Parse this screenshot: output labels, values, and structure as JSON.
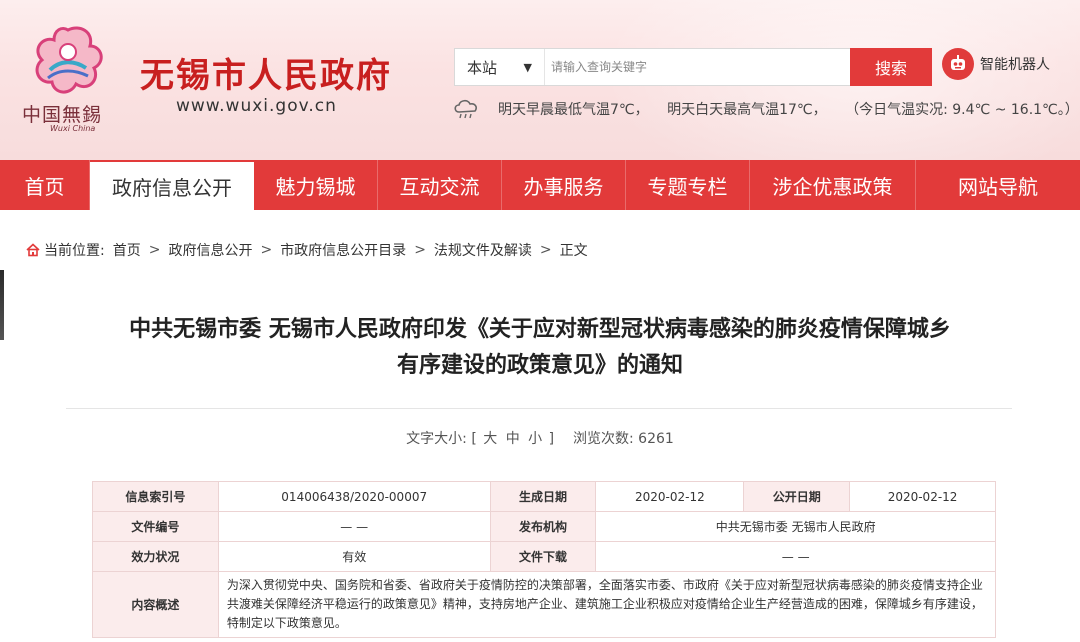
{
  "header": {
    "logo_caption": "中国無錫",
    "logo_sub": "Wuxi China",
    "site_title": "无锡市人民政府",
    "site_url": "www.wuxi.gov.cn",
    "search": {
      "scope": "本站",
      "placeholder": "请输入查询关键字",
      "button_label": "搜索"
    },
    "robot_label": "智能机器人",
    "weather": {
      "low": "明天早晨最低气温7℃，",
      "high": "明天白天最高气温17℃，",
      "today": "（今日气温实况: 9.4℃ ~ 16.1℃。）"
    }
  },
  "nav": {
    "items": [
      {
        "label": "首页"
      },
      {
        "label": "政府信息公开",
        "active": true
      },
      {
        "label": "魅力锡城"
      },
      {
        "label": "互动交流"
      },
      {
        "label": "办事服务"
      },
      {
        "label": "专题专栏"
      },
      {
        "label": "涉企优惠政策"
      },
      {
        "label": "网站导航"
      }
    ]
  },
  "breadcrumb": {
    "prefix": "当前位置:",
    "items": [
      "首页",
      "政府信息公开",
      "市政府信息公开目录",
      "法规文件及解读"
    ],
    "current": "正文"
  },
  "article": {
    "title_line1": "中共无锡市委 无锡市人民政府印发《关于应对新型冠状病毒感染的肺炎疫情保障城乡",
    "title_line2": "有序建设的政策意见》的通知",
    "font_size_label": "文字大小: [",
    "size_large": "大",
    "size_medium": "中",
    "size_small": "小",
    "font_size_close": "]",
    "views_label": "浏览次数:",
    "views": "6261"
  },
  "info_table": {
    "index_label": "信息索引号",
    "index_value": "014006438/2020-00007",
    "gen_date_label": "生成日期",
    "gen_date_value": "2020-02-12",
    "pub_date_label": "公开日期",
    "pub_date_value": "2020-02-12",
    "doc_no_label": "文件编号",
    "doc_no_value": "— —",
    "issuer_label": "发布机构",
    "issuer_value": "中共无锡市委 无锡市人民政府",
    "status_label": "效力状况",
    "status_value": "有效",
    "download_label": "文件下载",
    "download_value": "— —",
    "summary_label": "内容概述",
    "summary_value": "为深入贯彻党中央、国务院和省委、省政府关于疫情防控的决策部署，全面落实市委、市政府《关于应对新型冠状病毒感染的肺炎疫情支持企业共渡难关保障经济平稳运行的政策意见》精神，支持房地产企业、建筑施工企业积极应对疫情给企业生产经营造成的困难，保障城乡有序建设，特制定以下政策意见。"
  },
  "colors": {
    "brand_red": "#e23a3a",
    "title_red": "#c81f1f",
    "table_label_bg": "#fbecec"
  }
}
